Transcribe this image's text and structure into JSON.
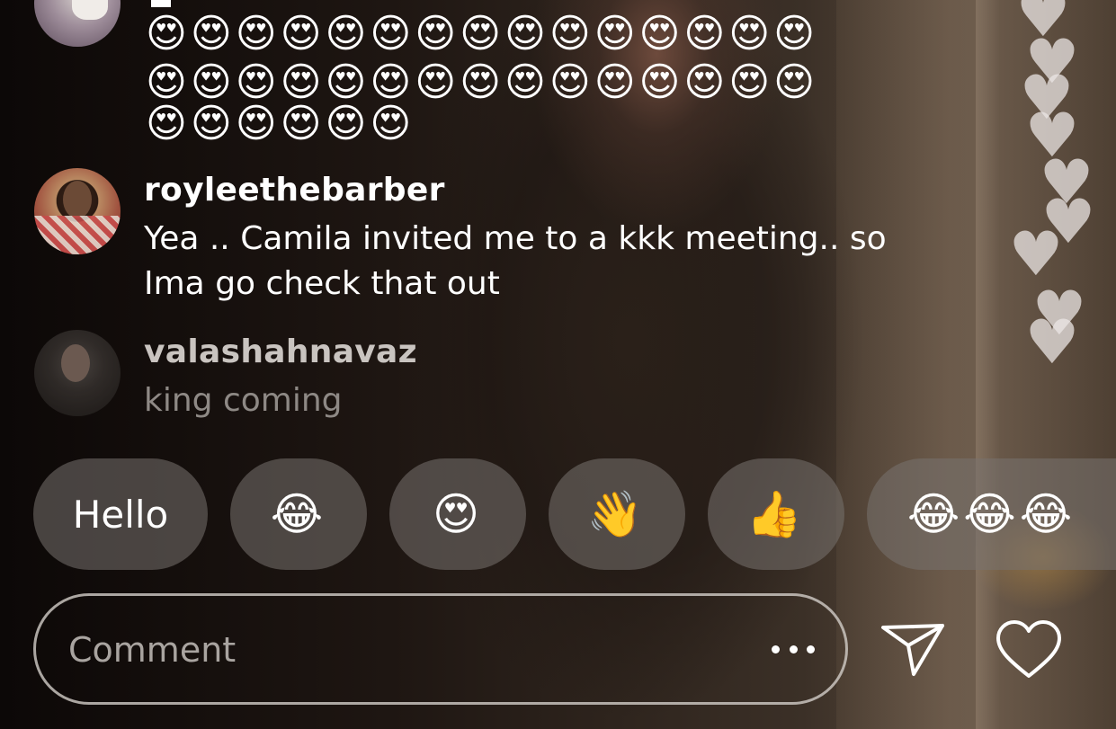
{
  "comments": [
    {
      "username": "",
      "emoji_lines": [
        "😍😍😍😍😍😍😍😍😍😍😍😍😍😍😍",
        "😍😍😍😍😍😍😍😍😍😍😍😍😍😍😍",
        "😍😍😍😍😍😍"
      ]
    },
    {
      "username": "royleethebarber",
      "message_lines": [
        "Yea .. Camila invited me to a kkk meeting.. so",
        "Ima go check that out"
      ]
    },
    {
      "username": "valashahnavaz",
      "message": "king coming"
    }
  ],
  "quick_reactions": [
    {
      "label": "Hello"
    },
    {
      "label": "😂"
    },
    {
      "label": "😍"
    },
    {
      "label": "👋"
    },
    {
      "label": "👍"
    },
    {
      "label": "😂😂😂"
    }
  ],
  "comment_input": {
    "placeholder": "Comment",
    "more_icon": "ellipsis-icon",
    "send_icon": "paper-plane-icon",
    "like_icon": "heart-outline-icon"
  },
  "floating_hearts": {
    "icon": "heart-icon",
    "count": 10,
    "color": "#ebe6e4"
  }
}
